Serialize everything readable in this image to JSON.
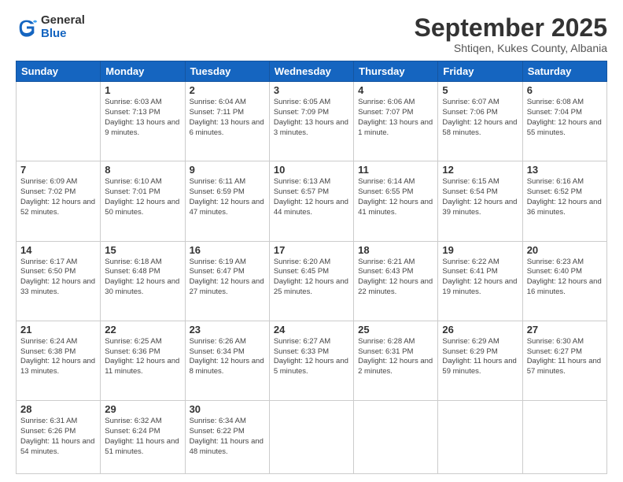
{
  "logo": {
    "line1": "General",
    "line2": "Blue"
  },
  "header": {
    "month": "September 2025",
    "location": "Shtiqen, Kukes County, Albania"
  },
  "weekdays": [
    "Sunday",
    "Monday",
    "Tuesday",
    "Wednesday",
    "Thursday",
    "Friday",
    "Saturday"
  ],
  "weeks": [
    [
      null,
      {
        "num": "1",
        "sunrise": "6:03 AM",
        "sunset": "7:13 PM",
        "daylight": "13 hours and 9 minutes."
      },
      {
        "num": "2",
        "sunrise": "6:04 AM",
        "sunset": "7:11 PM",
        "daylight": "13 hours and 6 minutes."
      },
      {
        "num": "3",
        "sunrise": "6:05 AM",
        "sunset": "7:09 PM",
        "daylight": "13 hours and 3 minutes."
      },
      {
        "num": "4",
        "sunrise": "6:06 AM",
        "sunset": "7:07 PM",
        "daylight": "13 hours and 1 minute."
      },
      {
        "num": "5",
        "sunrise": "6:07 AM",
        "sunset": "7:06 PM",
        "daylight": "12 hours and 58 minutes."
      },
      {
        "num": "6",
        "sunrise": "6:08 AM",
        "sunset": "7:04 PM",
        "daylight": "12 hours and 55 minutes."
      }
    ],
    [
      {
        "num": "7",
        "sunrise": "6:09 AM",
        "sunset": "7:02 PM",
        "daylight": "12 hours and 52 minutes."
      },
      {
        "num": "8",
        "sunrise": "6:10 AM",
        "sunset": "7:01 PM",
        "daylight": "12 hours and 50 minutes."
      },
      {
        "num": "9",
        "sunrise": "6:11 AM",
        "sunset": "6:59 PM",
        "daylight": "12 hours and 47 minutes."
      },
      {
        "num": "10",
        "sunrise": "6:13 AM",
        "sunset": "6:57 PM",
        "daylight": "12 hours and 44 minutes."
      },
      {
        "num": "11",
        "sunrise": "6:14 AM",
        "sunset": "6:55 PM",
        "daylight": "12 hours and 41 minutes."
      },
      {
        "num": "12",
        "sunrise": "6:15 AM",
        "sunset": "6:54 PM",
        "daylight": "12 hours and 39 minutes."
      },
      {
        "num": "13",
        "sunrise": "6:16 AM",
        "sunset": "6:52 PM",
        "daylight": "12 hours and 36 minutes."
      }
    ],
    [
      {
        "num": "14",
        "sunrise": "6:17 AM",
        "sunset": "6:50 PM",
        "daylight": "12 hours and 33 minutes."
      },
      {
        "num": "15",
        "sunrise": "6:18 AM",
        "sunset": "6:48 PM",
        "daylight": "12 hours and 30 minutes."
      },
      {
        "num": "16",
        "sunrise": "6:19 AM",
        "sunset": "6:47 PM",
        "daylight": "12 hours and 27 minutes."
      },
      {
        "num": "17",
        "sunrise": "6:20 AM",
        "sunset": "6:45 PM",
        "daylight": "12 hours and 25 minutes."
      },
      {
        "num": "18",
        "sunrise": "6:21 AM",
        "sunset": "6:43 PM",
        "daylight": "12 hours and 22 minutes."
      },
      {
        "num": "19",
        "sunrise": "6:22 AM",
        "sunset": "6:41 PM",
        "daylight": "12 hours and 19 minutes."
      },
      {
        "num": "20",
        "sunrise": "6:23 AM",
        "sunset": "6:40 PM",
        "daylight": "12 hours and 16 minutes."
      }
    ],
    [
      {
        "num": "21",
        "sunrise": "6:24 AM",
        "sunset": "6:38 PM",
        "daylight": "12 hours and 13 minutes."
      },
      {
        "num": "22",
        "sunrise": "6:25 AM",
        "sunset": "6:36 PM",
        "daylight": "12 hours and 11 minutes."
      },
      {
        "num": "23",
        "sunrise": "6:26 AM",
        "sunset": "6:34 PM",
        "daylight": "12 hours and 8 minutes."
      },
      {
        "num": "24",
        "sunrise": "6:27 AM",
        "sunset": "6:33 PM",
        "daylight": "12 hours and 5 minutes."
      },
      {
        "num": "25",
        "sunrise": "6:28 AM",
        "sunset": "6:31 PM",
        "daylight": "12 hours and 2 minutes."
      },
      {
        "num": "26",
        "sunrise": "6:29 AM",
        "sunset": "6:29 PM",
        "daylight": "11 hours and 59 minutes."
      },
      {
        "num": "27",
        "sunrise": "6:30 AM",
        "sunset": "6:27 PM",
        "daylight": "11 hours and 57 minutes."
      }
    ],
    [
      {
        "num": "28",
        "sunrise": "6:31 AM",
        "sunset": "6:26 PM",
        "daylight": "11 hours and 54 minutes."
      },
      {
        "num": "29",
        "sunrise": "6:32 AM",
        "sunset": "6:24 PM",
        "daylight": "11 hours and 51 minutes."
      },
      {
        "num": "30",
        "sunrise": "6:34 AM",
        "sunset": "6:22 PM",
        "daylight": "11 hours and 48 minutes."
      },
      null,
      null,
      null,
      null
    ]
  ]
}
